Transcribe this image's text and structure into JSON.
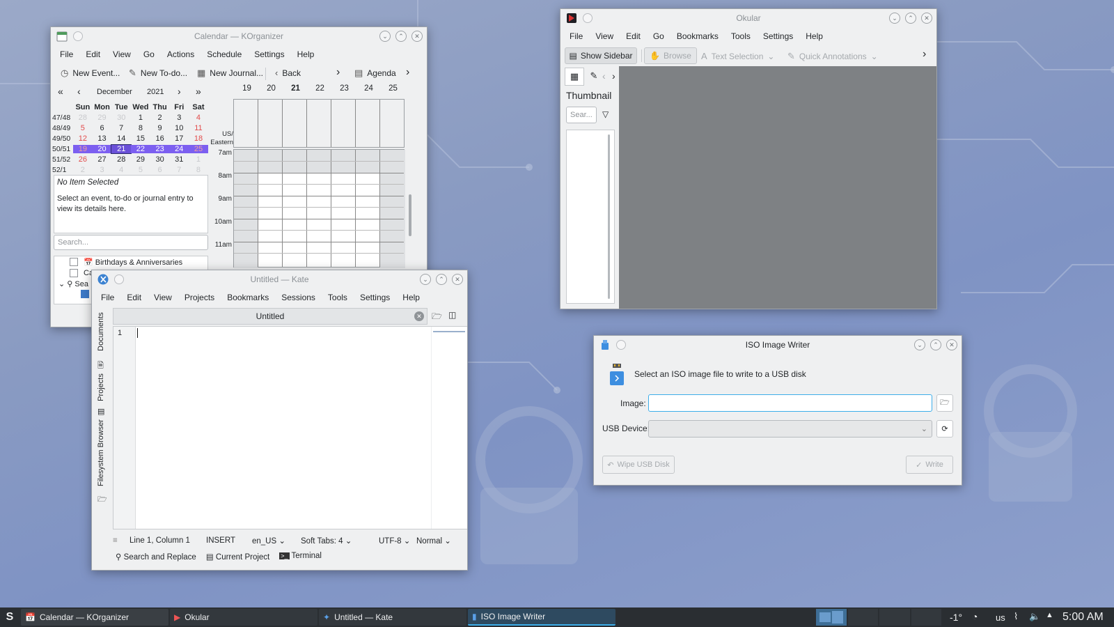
{
  "korganizer": {
    "title": "Calendar — KOrganizer",
    "menu": [
      "File",
      "Edit",
      "View",
      "Go",
      "Actions",
      "Schedule",
      "Settings",
      "Help"
    ],
    "toolbar": {
      "new_event": "New Event...",
      "new_todo": "New To-do...",
      "new_journal": "New Journal...",
      "back": "Back",
      "agenda": "Agenda"
    },
    "month": "December",
    "year": "2021",
    "weekdays": [
      "Sun",
      "Mon",
      "Tue",
      "Wed",
      "Thu",
      "Fri",
      "Sat"
    ],
    "weeks": [
      {
        "wk": "47/48",
        "days": [
          "28",
          "29",
          "30",
          "1",
          "2",
          "3",
          "4"
        ]
      },
      {
        "wk": "48/49",
        "days": [
          "5",
          "6",
          "7",
          "8",
          "9",
          "10",
          "11"
        ]
      },
      {
        "wk": "49/50",
        "days": [
          "12",
          "13",
          "14",
          "15",
          "16",
          "17",
          "18"
        ]
      },
      {
        "wk": "50/51",
        "days": [
          "19",
          "20",
          "21",
          "22",
          "23",
          "24",
          "25"
        ]
      },
      {
        "wk": "51/52",
        "days": [
          "26",
          "27",
          "28",
          "29",
          "30",
          "31",
          "1"
        ]
      },
      {
        "wk": "52/1",
        "days": [
          "2",
          "3",
          "4",
          "5",
          "6",
          "7",
          "8"
        ]
      }
    ],
    "day_headers": [
      "19",
      "20",
      "21",
      "22",
      "23",
      "24",
      "25"
    ],
    "timezone": "US/\nEastern",
    "hours": [
      "7am",
      "8am",
      "9am",
      "10am",
      "11am"
    ],
    "no_item": "No Item Selected",
    "hint": "Select an event, to-do or journal entry to view its details here.",
    "search_placeholder": "Search...",
    "calendars": [
      "Birthdays & Anniversaries",
      "Calendar",
      "Sea"
    ]
  },
  "okular": {
    "title": "Okular",
    "menu": [
      "File",
      "View",
      "Edit",
      "Go",
      "Bookmarks",
      "Tools",
      "Settings",
      "Help"
    ],
    "toolbar": {
      "show_sidebar": "Show Sidebar",
      "browse": "Browse",
      "text_selection": "Text Selection",
      "quick_annotations": "Quick Annotations"
    },
    "panel_title": "Thumbnail",
    "search_placeholder": "Sear..."
  },
  "kate": {
    "title": "Untitled — Kate",
    "menu": [
      "File",
      "Edit",
      "View",
      "Projects",
      "Bookmarks",
      "Sessions",
      "Tools",
      "Settings",
      "Help"
    ],
    "tab": "Untitled",
    "line_number": "1",
    "side_tabs": [
      "Documents",
      "Projects",
      "Filesystem Browser"
    ],
    "status": {
      "position": "Line 1, Column 1",
      "mode": "INSERT",
      "lang": "en_US",
      "tabs": "Soft Tabs: 4",
      "encoding": "UTF-8",
      "hl": "Normal"
    },
    "bottom": {
      "search": "Search and Replace",
      "project": "Current Project",
      "terminal": "Terminal"
    }
  },
  "isowriter": {
    "title": "ISO Image Writer",
    "prompt": "Select an ISO image file to write to a USB disk",
    "image_label": "Image:",
    "usb_label": "USB Device:",
    "wipe": "Wipe USB Disk",
    "write": "Write"
  },
  "taskbar": {
    "tasks": [
      "Calendar — KOrganizer",
      "Okular",
      "Untitled — Kate",
      "ISO Image Writer"
    ],
    "temp": "-1°",
    "layout": "us",
    "clock": "5:00 AM"
  },
  "colors": {
    "selection": "#7c5ff0",
    "taskbar": "#2a2e32",
    "accent": "#3daee9"
  }
}
